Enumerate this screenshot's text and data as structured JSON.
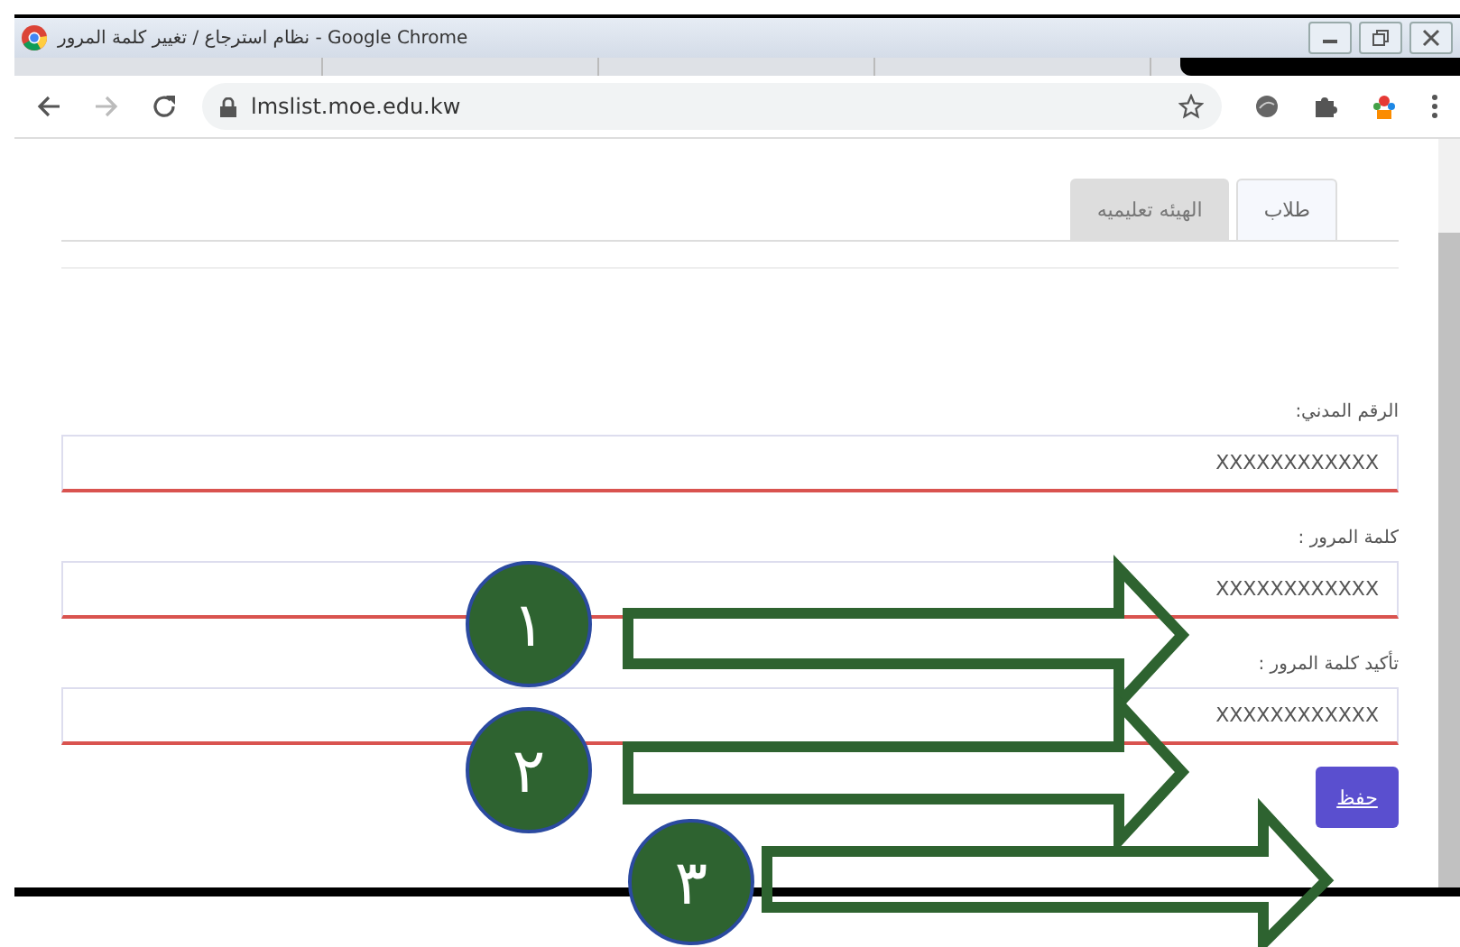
{
  "window": {
    "title": "نظام استرجاع / تغيير كلمة المرور - Google Chrome"
  },
  "address_bar": {
    "url": "lmslist.moe.edu.kw"
  },
  "tabs": [
    {
      "label": "طلاب",
      "selected": true
    },
    {
      "label": "الهيئه تعليميه",
      "selected": false
    }
  ],
  "fields": [
    {
      "label": "الرقم المدني:",
      "value": "XXXXXXXXXXXX"
    },
    {
      "label": "كلمة المرور :",
      "value": "XXXXXXXXXXXX"
    },
    {
      "label": "تأكيد كلمة المرور :",
      "value": "XXXXXXXXXXXX"
    }
  ],
  "save_button": "حفظ",
  "annotations": [
    {
      "number": "١"
    },
    {
      "number": "٢"
    },
    {
      "number": "٣"
    }
  ]
}
